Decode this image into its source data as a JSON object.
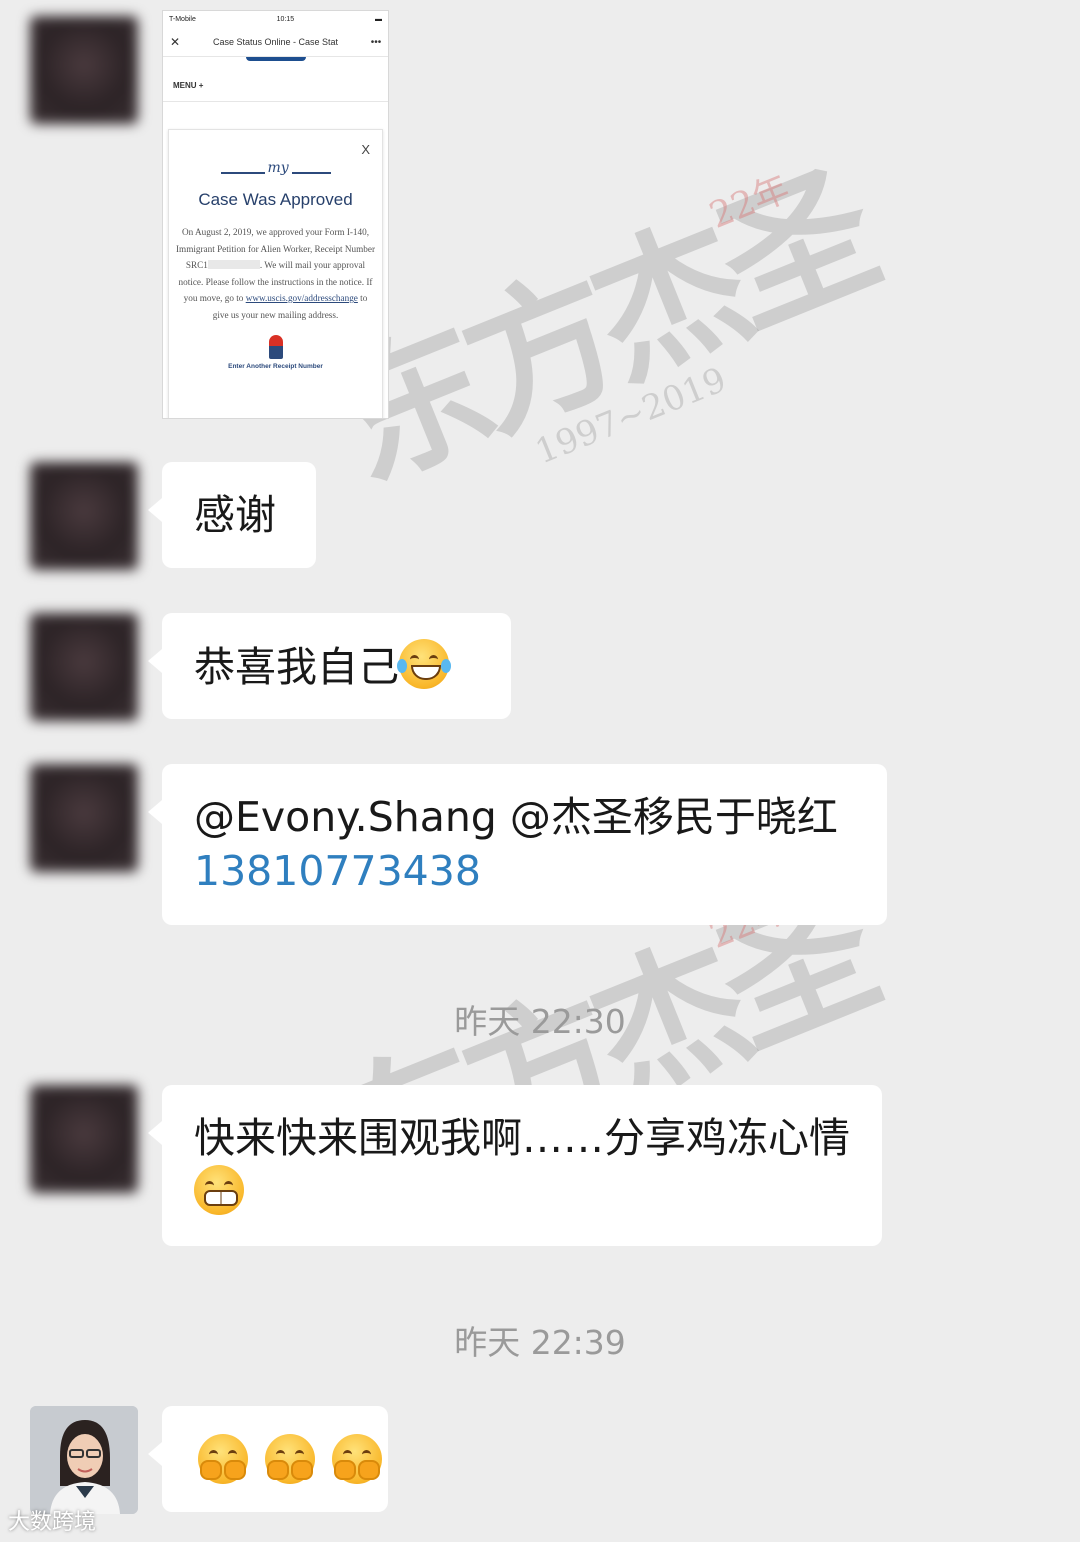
{
  "screenshot": {
    "status": {
      "carrier": "T-Mobile",
      "time": "10:15"
    },
    "nav": {
      "close": "✕",
      "title": "Case Status Online - Case Stat",
      "more": "•••"
    },
    "menu_label": "MENU +",
    "card": {
      "close": "X",
      "title": "Case Was Approved",
      "body_before": "On August 2, 2019, we approved your Form I-140, Immigrant Petition for Alien Worker, Receipt Number SRC1",
      "body_middle": ". We will mail your approval notice. Please follow the instructions in the notice. If you move, go to ",
      "link": "www.uscis.gov/addresschange",
      "body_after": " to give us your new mailing address.",
      "enter_label": "Enter Another Receipt Number"
    }
  },
  "messages": [
    {
      "text": "感谢"
    },
    {
      "text": "恭喜我自己",
      "emoji": "tears-of-joy"
    },
    {
      "mention": "@Evony.Shang @杰圣移民于晓红",
      "phone": "13810773438"
    },
    {
      "text": "快来快来围观我啊……分享鸡冻心情",
      "emoji": "grimacing"
    },
    {
      "emoji": [
        "hugging",
        "hugging",
        "hugging"
      ]
    }
  ],
  "timestamps": [
    "昨天 22:30",
    "昨天 22:39"
  ],
  "watermark": {
    "big": "东方杰圣",
    "years": "1997~2019",
    "badge": "22年"
  },
  "corner_watermark": "大数跨境"
}
